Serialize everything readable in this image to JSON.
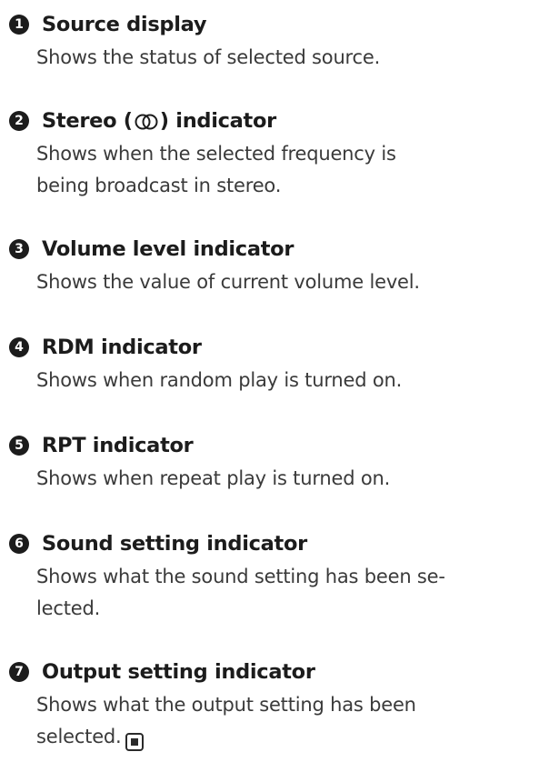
{
  "entries": [
    {
      "number": "1",
      "title": "Source display",
      "description_lines": [
        "Shows the status of selected source."
      ]
    },
    {
      "number": "2",
      "title_before": "Stereo (",
      "title_after": ") indicator",
      "title_icon": "stereo-circles-icon",
      "description_lines": [
        "Shows when the selected frequency is",
        "being broadcast in stereo."
      ]
    },
    {
      "number": "3",
      "title": "Volume level indicator",
      "description_lines": [
        "Shows the value of current volume level."
      ]
    },
    {
      "number": "4",
      "title": "RDM indicator",
      "description_lines": [
        "Shows when random play is turned on."
      ]
    },
    {
      "number": "5",
      "title": "RPT indicator",
      "description_lines": [
        "Shows when repeat play is turned on."
      ]
    },
    {
      "number": "6",
      "title": "Sound setting indicator",
      "description_lines": [
        "Shows what the sound setting has been se-",
        "lected."
      ]
    },
    {
      "number": "7",
      "title": "Output setting indicator",
      "description_lines": [
        "Shows what the output setting has been",
        "selected."
      ],
      "end_icon": "end-of-section-icon"
    }
  ]
}
